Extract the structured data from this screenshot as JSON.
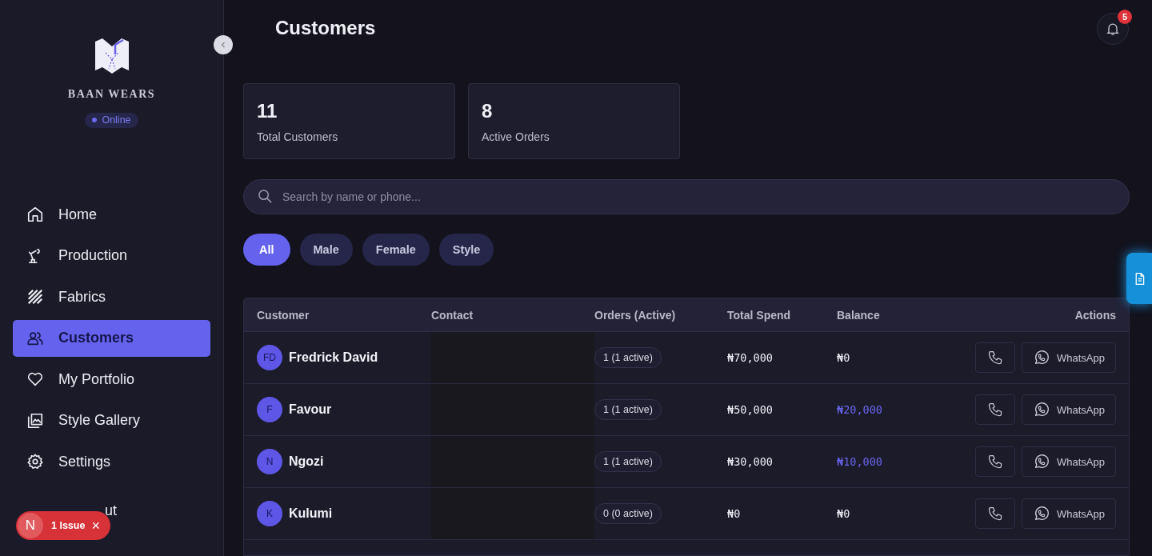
{
  "sidebar": {
    "brand": "BAAN WEARS",
    "status": "Online",
    "nav": [
      {
        "label": "Home",
        "selected": false
      },
      {
        "label": "Production",
        "selected": false
      },
      {
        "label": "Fabrics",
        "selected": false
      },
      {
        "label": "Customers",
        "selected": true
      },
      {
        "label": "My Portfolio",
        "selected": false
      },
      {
        "label": "Style Gallery",
        "selected": false
      },
      {
        "label": "Settings",
        "selected": false
      }
    ],
    "covered_item": "ut"
  },
  "issue_toast": {
    "avatar": "N",
    "label": "1 Issue",
    "close": "×"
  },
  "header": {
    "title": "Customers",
    "notifications": "5"
  },
  "stats": [
    {
      "value": "11",
      "label": "Total Customers"
    },
    {
      "value": "8",
      "label": "Active Orders"
    }
  ],
  "search": {
    "placeholder": "Search by name or phone..."
  },
  "filters": [
    {
      "label": "All",
      "selected": true
    },
    {
      "label": "Male",
      "selected": false
    },
    {
      "label": "Female",
      "selected": false
    },
    {
      "label": "Style",
      "selected": false
    }
  ],
  "table": {
    "columns": [
      "Customer",
      "Contact",
      "Orders (Active)",
      "Total Spend",
      "Balance",
      "Actions"
    ],
    "rows": [
      {
        "initials": "FD",
        "name": "Fredrick David",
        "orders": "1 (1 active)",
        "spend": "₦70,000",
        "balance": "₦0",
        "outstanding": false,
        "whatsapp": "WhatsApp"
      },
      {
        "initials": "F",
        "name": "Favour",
        "orders": "1 (1 active)",
        "spend": "₦50,000",
        "balance": "₦20,000",
        "outstanding": true,
        "whatsapp": "WhatsApp"
      },
      {
        "initials": "N",
        "name": "Ngozi",
        "orders": "1 (1 active)",
        "spend": "₦30,000",
        "balance": "₦10,000",
        "outstanding": true,
        "whatsapp": "WhatsApp"
      },
      {
        "initials": "K",
        "name": "Kulumi",
        "orders": "0 (0 active)",
        "spend": "₦0",
        "balance": "₦0",
        "outstanding": false,
        "whatsapp": "WhatsApp"
      }
    ]
  }
}
